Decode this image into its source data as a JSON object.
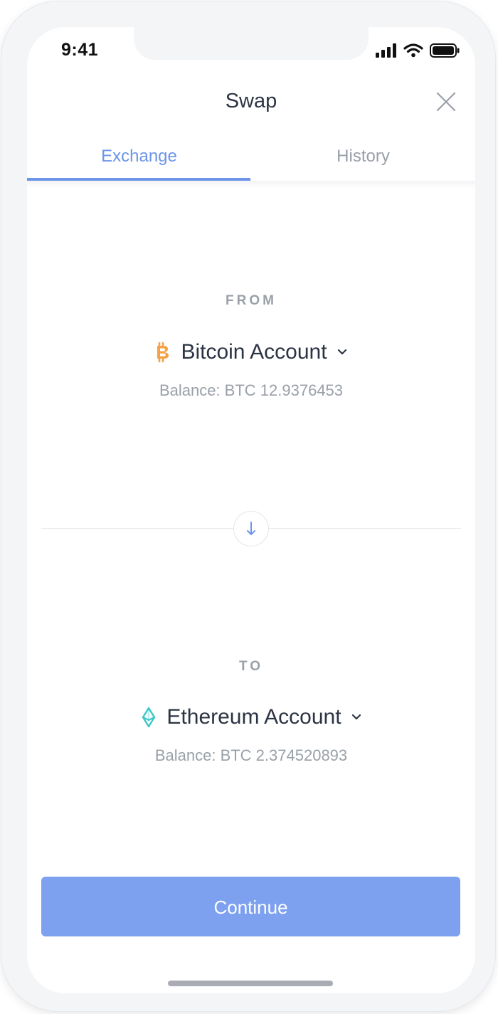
{
  "status_bar": {
    "time": "9:41"
  },
  "header": {
    "title": "Swap"
  },
  "tabs": [
    {
      "label": "Exchange",
      "active": true
    },
    {
      "label": "History",
      "active": false
    }
  ],
  "from": {
    "label": "FROM",
    "account_name": "Bitcoin Account",
    "icon": "bitcoin-icon",
    "icon_color": "#f5a146",
    "balance": "Balance: BTC 12.9376453"
  },
  "to": {
    "label": "TO",
    "account_name": "Ethereum Account",
    "icon": "ethereum-icon",
    "icon_color": "#3cc8c8",
    "balance": "Balance: BTC 2.374520893"
  },
  "actions": {
    "continue_label": "Continue"
  },
  "colors": {
    "accent": "#6c95e9",
    "button": "#7da0ef",
    "text_primary": "#2c3443",
    "text_secondary": "#9aa0a8"
  }
}
